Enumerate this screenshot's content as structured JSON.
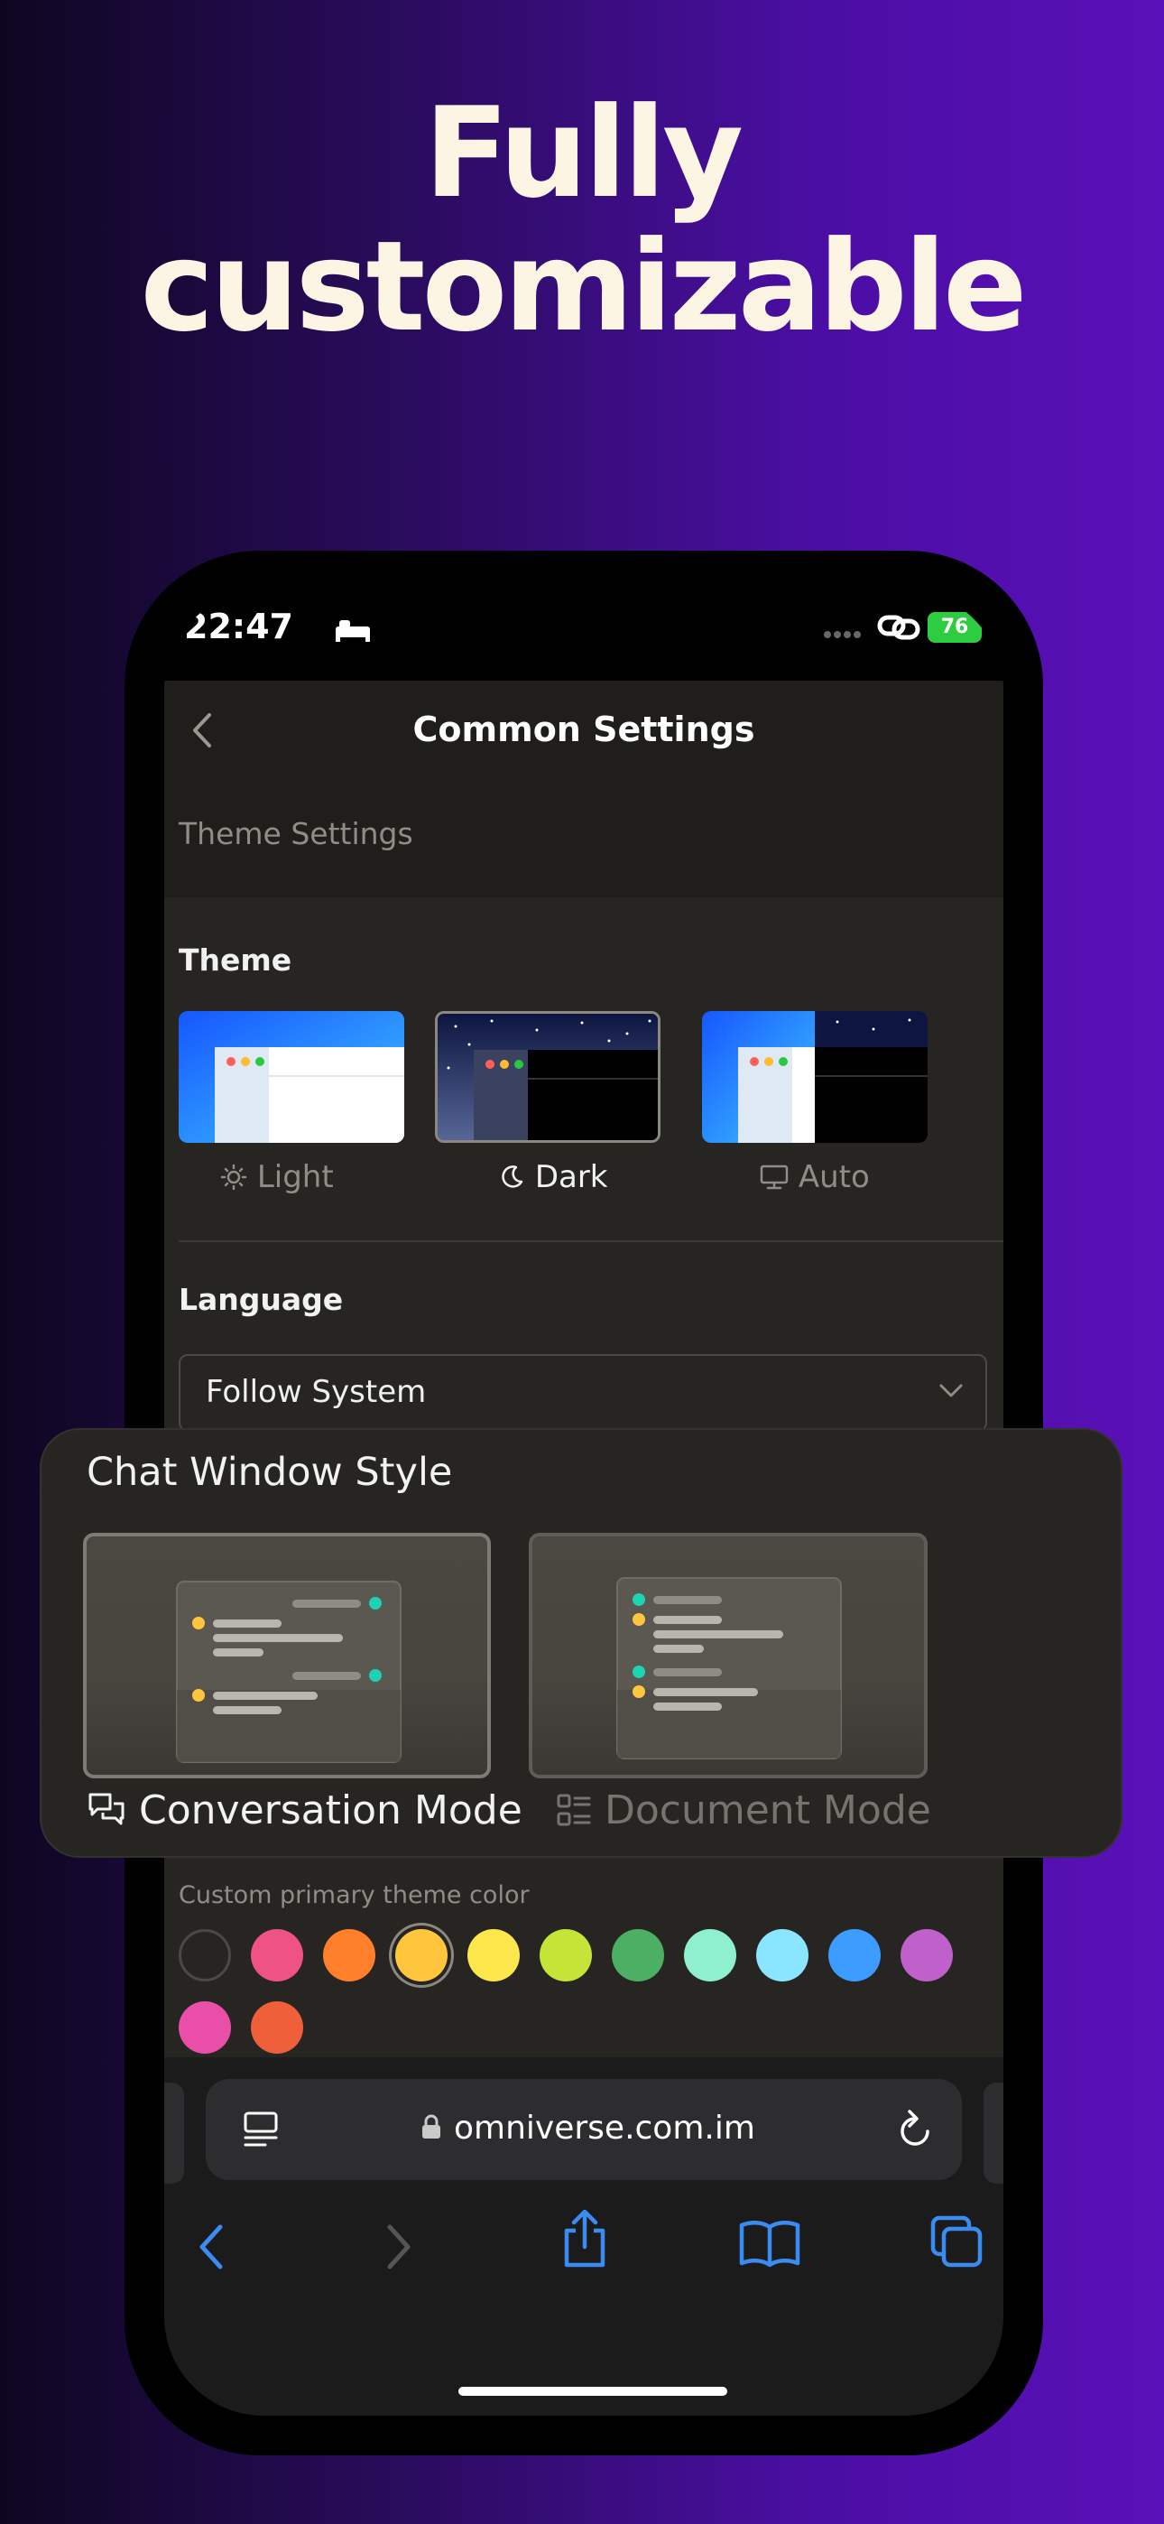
{
  "promo": {
    "line1": "Fully",
    "line2": "customizable"
  },
  "status_bar": {
    "time": "22:47",
    "battery": "76"
  },
  "nav": {
    "title": "Common Settings"
  },
  "section": {
    "label": "Theme Settings"
  },
  "theme": {
    "heading": "Theme",
    "options": [
      {
        "label": "Light",
        "icon": "sun-icon",
        "selected": false
      },
      {
        "label": "Dark",
        "icon": "moon-icon",
        "selected": true
      },
      {
        "label": "Auto",
        "icon": "monitor-icon",
        "selected": false
      }
    ]
  },
  "language": {
    "heading": "Language",
    "value": "Follow System"
  },
  "chat_style": {
    "title": "Chat Window Style",
    "options": [
      {
        "label": "Conversation Mode",
        "icon": "chat-bubbles-icon",
        "selected": true
      },
      {
        "label": "Document Mode",
        "icon": "document-list-icon",
        "selected": false
      }
    ]
  },
  "custom_color": {
    "label": "Custom primary theme color",
    "swatches": [
      "#262522",
      "#ef5285",
      "#ff7f2a",
      "#ffc53d",
      "#fde74c",
      "#c4e538",
      "#4caf63",
      "#8ff0d0",
      "#8ae6ff",
      "#3d9cff",
      "#c061cb",
      "#e94fa8",
      "#ee5f3a"
    ],
    "selected_index": 3
  },
  "browser": {
    "url": "omniverse.com.im"
  },
  "colors": {
    "accent": "#3b8cf0",
    "background": "#262522",
    "battery": "#2ecc40"
  }
}
